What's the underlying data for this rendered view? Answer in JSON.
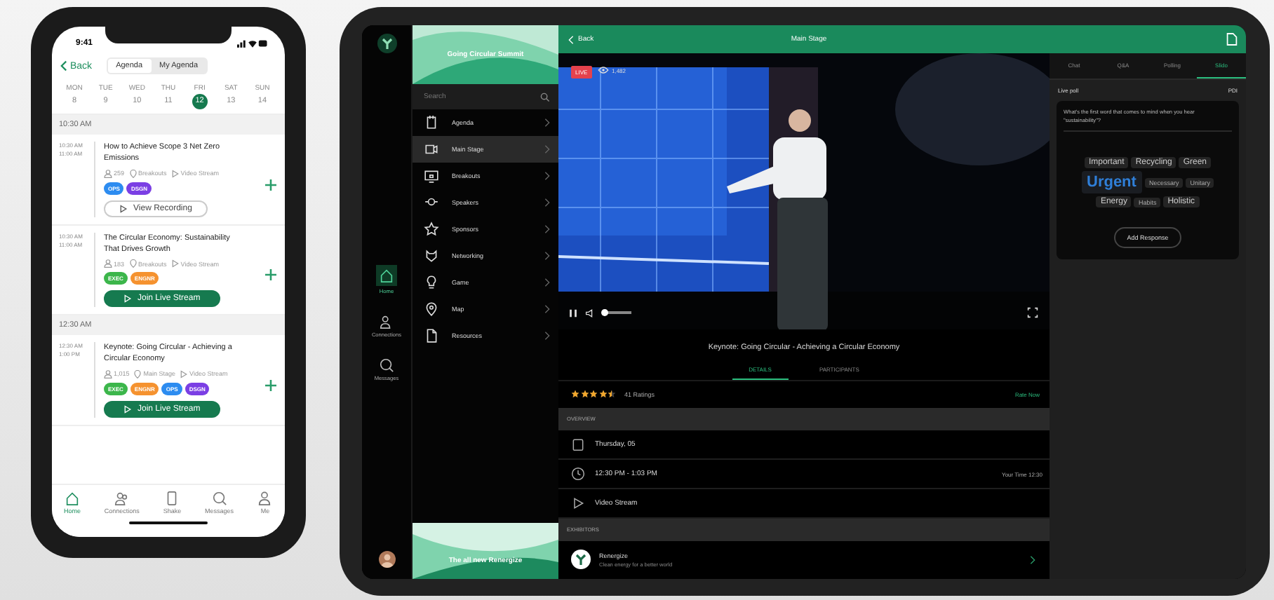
{
  "phone": {
    "status_time": "9:41",
    "back": "Back",
    "segments": [
      {
        "label": "Agenda",
        "selected": true
      },
      {
        "label": "My Agenda",
        "selected": false
      }
    ],
    "days": [
      {
        "weekday": "MON",
        "date": "8",
        "selected": false
      },
      {
        "weekday": "TUE",
        "date": "9",
        "selected": false
      },
      {
        "weekday": "WED",
        "date": "10",
        "selected": false
      },
      {
        "weekday": "THU",
        "date": "11",
        "selected": false
      },
      {
        "weekday": "FRI",
        "date": "12",
        "selected": true
      },
      {
        "weekday": "SAT",
        "date": "13",
        "selected": false
      },
      {
        "weekday": "SUN",
        "date": "14",
        "selected": false
      }
    ],
    "groups": [
      {
        "heading": "10:30 AM",
        "sessions": [
          {
            "start": "10:30 AM",
            "end": "11:00 AM",
            "title": "How to Achieve Scope 3 Net Zero Emissions",
            "attendees": "259",
            "location": "Breakouts",
            "stream": "Video Stream",
            "tags": [
              {
                "label": "OPS",
                "color": "#2d8cf0"
              },
              {
                "label": "DSGN",
                "color": "#7b3fe4"
              }
            ],
            "button": {
              "label": "View Recording",
              "kind": "outline"
            }
          },
          {
            "start": "10:30 AM",
            "end": "11:00 AM",
            "title": "The Circular Economy: Sustainability That Drives Growth",
            "attendees": "183",
            "location": "Breakouts",
            "stream": "Video Stream",
            "tags": [
              {
                "label": "EXEC",
                "color": "#3cb64b"
              },
              {
                "label": "ENGNR",
                "color": "#f5922f"
              }
            ],
            "button": {
              "label": "Join Live Stream",
              "kind": "filled"
            }
          }
        ]
      },
      {
        "heading": "12:30 AM",
        "sessions": [
          {
            "start": "12:30 AM",
            "end": "1:00 PM",
            "title": "Keynote: Going Circular - Achieving a Circular Economy",
            "attendees": "1,015",
            "location": "Main Stage",
            "stream": "Video Stream",
            "tags": [
              {
                "label": "EXEC",
                "color": "#3cb64b"
              },
              {
                "label": "ENGNR",
                "color": "#f5922f"
              },
              {
                "label": "OPS",
                "color": "#2d8cf0"
              },
              {
                "label": "DSGN",
                "color": "#7b3fe4"
              }
            ],
            "button": {
              "label": "Join Live Stream",
              "kind": "filled"
            }
          }
        ]
      }
    ],
    "tabbar": [
      {
        "label": "Home",
        "selected": true
      },
      {
        "label": "Connections",
        "selected": false
      },
      {
        "label": "Shake",
        "selected": false
      },
      {
        "label": "Messages",
        "selected": false
      },
      {
        "label": "Me",
        "selected": false
      }
    ]
  },
  "tablet": {
    "rail": [
      {
        "label": "Home",
        "selected": true
      },
      {
        "label": "Connections",
        "selected": false
      },
      {
        "label": "Messages",
        "selected": false
      }
    ],
    "nav": {
      "event_title": "Going Circular Summit",
      "search_placeholder": "Search",
      "items": [
        {
          "label": "Agenda",
          "selected": false
        },
        {
          "label": "Main Stage",
          "selected": true
        },
        {
          "label": "Breakouts",
          "selected": false
        },
        {
          "label": "Speakers",
          "selected": false
        },
        {
          "label": "Sponsors",
          "selected": false
        },
        {
          "label": "Networking",
          "selected": false
        },
        {
          "label": "Game",
          "selected": false
        },
        {
          "label": "Map",
          "selected": false
        },
        {
          "label": "Resources",
          "selected": false
        }
      ],
      "banner": "The all new Renergize"
    },
    "header": {
      "back": "Back",
      "title": "Main Stage"
    },
    "video": {
      "badge": "LIVE",
      "viewers": "1,482",
      "volume": {
        "level": 0.12
      }
    },
    "session_title": "Keynote: Going Circular - Achieving a Circular Economy",
    "tabs": [
      {
        "label": "DETAILS",
        "selected": true
      },
      {
        "label": "PARTICIPANTS",
        "selected": false
      }
    ],
    "rating": {
      "stars": 4.5,
      "count": "41 Ratings",
      "action": "Rate Now"
    },
    "overview": {
      "heading": "OVERVIEW",
      "rows": [
        {
          "text": "Thursday, 05"
        },
        {
          "text": "12:30 PM - 1:03 PM",
          "aside": "Your Time 12:30"
        },
        {
          "text": "Video Stream"
        }
      ]
    },
    "exhibitors": {
      "heading": "EXHIBITORS",
      "items": [
        {
          "name": "Renergize",
          "tagline": "Clean energy for a better world"
        }
      ]
    },
    "side_tabs": [
      {
        "label": "Chat",
        "selected": false
      },
      {
        "label": "Q&A",
        "selected": false
      },
      {
        "label": "Polling",
        "selected": false
      },
      {
        "label": "Slido",
        "selected": true
      }
    ],
    "poll": {
      "label": "Live poll",
      "code": "PDI",
      "question": "What's the first word that comes to mind when you hear \"sustainability\"?",
      "words": [
        {
          "text": "Important",
          "kind": "medium"
        },
        {
          "text": "Recycling",
          "kind": "medium"
        },
        {
          "text": "Green",
          "kind": "medium"
        },
        {
          "text": "Urgent",
          "kind": "large"
        },
        {
          "text": "Necessary",
          "kind": "small"
        },
        {
          "text": "Unitary",
          "kind": "small"
        },
        {
          "text": "Energy",
          "kind": "medium"
        },
        {
          "text": "Habits",
          "kind": "small"
        },
        {
          "text": "Holistic",
          "kind": "medium"
        }
      ],
      "button": "Add Response"
    }
  }
}
